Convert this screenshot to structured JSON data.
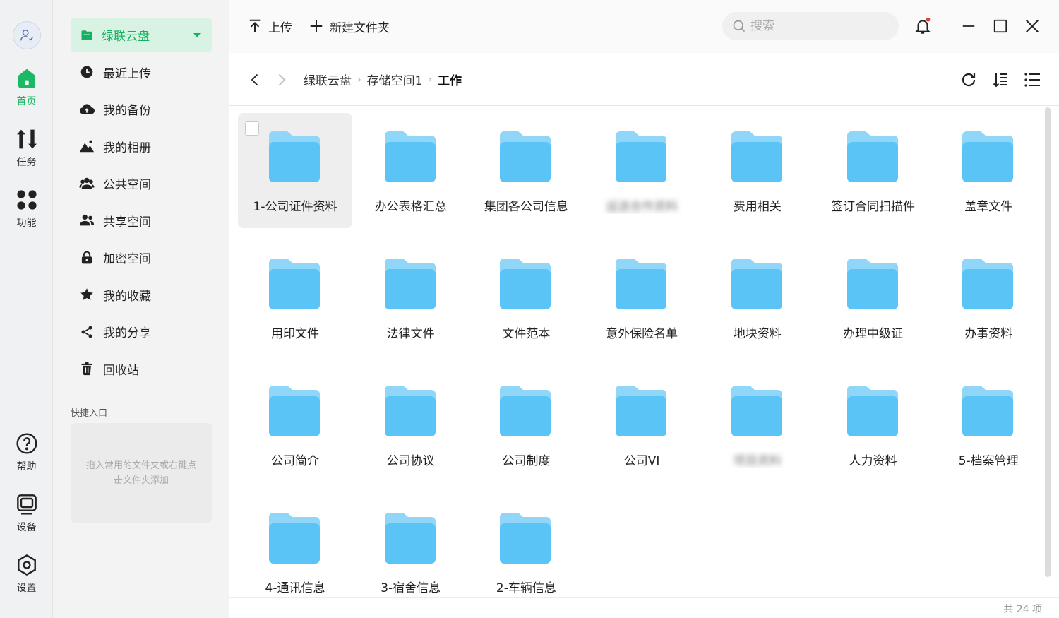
{
  "rail": {
    "items": [
      {
        "label": "首页",
        "icon": "home-icon",
        "active": true
      },
      {
        "label": "任务",
        "icon": "transfer-icon"
      },
      {
        "label": "功能",
        "icon": "apps-grid-icon"
      }
    ],
    "bottom_items": [
      {
        "label": "帮助",
        "icon": "help-icon"
      },
      {
        "label": "设备",
        "icon": "device-icon"
      },
      {
        "label": "设置",
        "icon": "settings-icon"
      }
    ]
  },
  "sidebar": {
    "drive_label": "绿联云盘",
    "items": [
      {
        "label": "最近上传",
        "icon": "clock-icon"
      },
      {
        "label": "我的备份",
        "icon": "cloud-backup-icon"
      },
      {
        "label": "我的相册",
        "icon": "mountain-photo-icon"
      },
      {
        "label": "公共空间",
        "icon": "group-icon"
      },
      {
        "label": "共享空间",
        "icon": "users-icon"
      },
      {
        "label": "加密空间",
        "icon": "lock-icon"
      },
      {
        "label": "我的收藏",
        "icon": "star-icon"
      },
      {
        "label": "我的分享",
        "icon": "share-icon"
      },
      {
        "label": "回收站",
        "icon": "trash-icon"
      }
    ],
    "quick_title": "快捷入口",
    "quick_hint": "拖入常用的文件夹或右键点击文件夹添加"
  },
  "toolbar": {
    "upload_label": "上传",
    "new_folder_label": "新建文件夹",
    "search_placeholder": "搜索"
  },
  "breadcrumb": [
    "绿联云盘",
    "存储空间1",
    "工作"
  ],
  "folders": [
    {
      "name": "1-公司证件资料",
      "selected": true
    },
    {
      "name": "办公表格汇总"
    },
    {
      "name": "集团各公司信息"
    },
    {
      "name": "运送合作资料",
      "blurred": true
    },
    {
      "name": "费用相关"
    },
    {
      "name": "签订合同扫描件"
    },
    {
      "name": "盖章文件"
    },
    {
      "name": "用印文件"
    },
    {
      "name": "法律文件"
    },
    {
      "name": "文件范本"
    },
    {
      "name": "意外保险名单"
    },
    {
      "name": "地块资料"
    },
    {
      "name": "办理中级证"
    },
    {
      "name": "办事资料"
    },
    {
      "name": "公司简介"
    },
    {
      "name": "公司协议"
    },
    {
      "name": "公司制度"
    },
    {
      "name": "公司VI"
    },
    {
      "name": "项目资料",
      "blurred": true
    },
    {
      "name": "人力资料"
    },
    {
      "name": "5-档案管理"
    },
    {
      "name": "4-通讯信息"
    },
    {
      "name": "3-宿舍信息"
    },
    {
      "name": "2-车辆信息"
    }
  ],
  "status": {
    "count": "共 24 项"
  },
  "colors": {
    "accent": "#1bb865",
    "folder": "#5ac4f6",
    "folder_back": "#8fd6f9",
    "badge": "#e53935"
  }
}
